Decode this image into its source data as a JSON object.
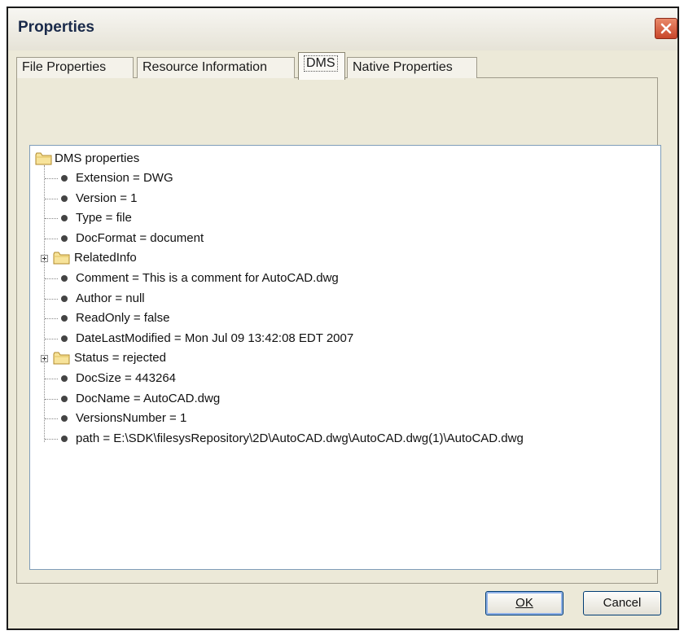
{
  "dialog": {
    "title": "Properties"
  },
  "tabs": [
    {
      "label": "File Properties"
    },
    {
      "label": "Resource Information"
    },
    {
      "label": "DMS",
      "active": true
    },
    {
      "label": "Native Properties"
    }
  ],
  "tree": {
    "root_label": "DMS properties",
    "items": [
      {
        "label": "Extension = DWG",
        "kind": "leaf"
      },
      {
        "label": "Version = 1",
        "kind": "leaf"
      },
      {
        "label": "Type = file",
        "kind": "leaf"
      },
      {
        "label": "DocFormat = document",
        "kind": "leaf"
      },
      {
        "label": "RelatedInfo",
        "kind": "folder"
      },
      {
        "label": "Comment = This is a comment for AutoCAD.dwg",
        "kind": "leaf"
      },
      {
        "label": "Author = null",
        "kind": "leaf"
      },
      {
        "label": "ReadOnly = false",
        "kind": "leaf"
      },
      {
        "label": "DateLastModified = Mon Jul 09 13:42:08 EDT 2007",
        "kind": "leaf"
      },
      {
        "label": "Status = rejected",
        "kind": "folder"
      },
      {
        "label": "DocSize = 443264",
        "kind": "leaf"
      },
      {
        "label": "DocName = AutoCAD.dwg",
        "kind": "leaf"
      },
      {
        "label": "VersionsNumber = 1",
        "kind": "leaf"
      },
      {
        "label": "path = E:\\SDK\\filesysRepository\\2D\\AutoCAD.dwg\\AutoCAD.dwg(1)\\AutoCAD.dwg",
        "kind": "leaf"
      }
    ]
  },
  "buttons": {
    "ok_label": "OK",
    "cancel_label": "Cancel"
  },
  "colors": {
    "dialog_bg": "#ECE9D8",
    "close_button": "#C8462A",
    "tree_border": "#7F9DB9"
  },
  "icons": {
    "close": "close-icon",
    "folder": "folder-icon",
    "expand": "plus-expander-icon",
    "leaf": "bullet-icon"
  }
}
